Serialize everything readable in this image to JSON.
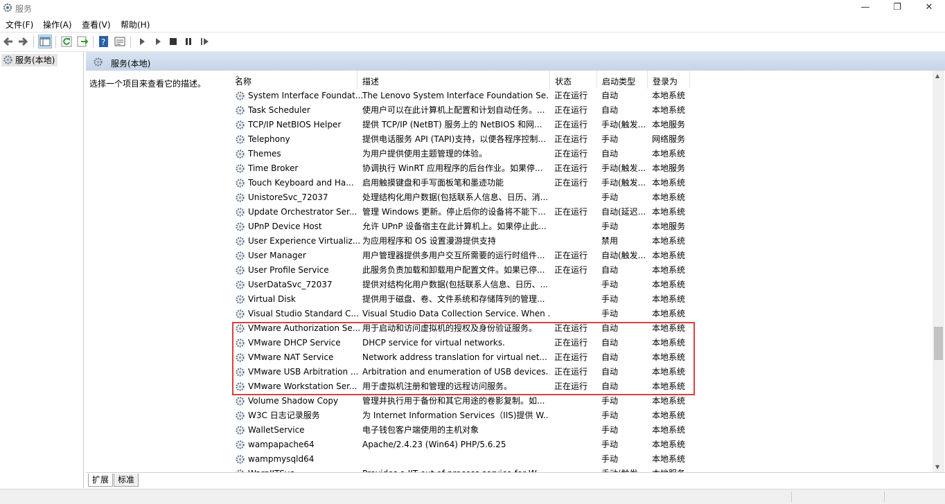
{
  "window": {
    "title": "服务",
    "minimize": "—",
    "maximize": "❐",
    "close": "✕"
  },
  "menu": [
    {
      "label": "文件(F)"
    },
    {
      "label": "操作(A)"
    },
    {
      "label": "查看(V)"
    },
    {
      "label": "帮助(H)"
    }
  ],
  "toolbar": {
    "icons": [
      "back-icon",
      "forward-icon",
      "show-hide-console-tree-icon",
      "refresh-icon",
      "export-list-icon",
      "help-icon",
      "properties-icon",
      "start-service-icon",
      "start-service-alt-icon",
      "stop-service-icon",
      "pause-service-icon",
      "resume-service-icon"
    ]
  },
  "tree": {
    "root_label": "服务(本地)"
  },
  "header": {
    "title": "服务(本地)"
  },
  "description_placeholder": "选择一个项目来查看它的描述。",
  "columns": {
    "name": "名称",
    "desc": "描述",
    "status": "状态",
    "startup": "启动类型",
    "logon": "登录为"
  },
  "services": [
    {
      "name": "System Interface Foundat...",
      "desc": "The Lenovo System Interface Foundation Se...",
      "status": "正在运行",
      "startup": "自动",
      "logon": "本地系统"
    },
    {
      "name": "Task Scheduler",
      "desc": "使用户可以在此计算机上配置和计划自动任务。...",
      "status": "正在运行",
      "startup": "自动",
      "logon": "本地系统"
    },
    {
      "name": "TCP/IP NetBIOS Helper",
      "desc": "提供 TCP/IP (NetBT) 服务上的 NetBIOS 和网...",
      "status": "正在运行",
      "startup": "手动(触发...",
      "logon": "本地服务"
    },
    {
      "name": "Telephony",
      "desc": "提供电话服务 API (TAPI)支持，以便各程序控制...",
      "status": "正在运行",
      "startup": "手动",
      "logon": "网络服务"
    },
    {
      "name": "Themes",
      "desc": "为用户提供使用主题管理的体验。",
      "status": "正在运行",
      "startup": "自动",
      "logon": "本地系统"
    },
    {
      "name": "Time Broker",
      "desc": "协调执行 WinRT 应用程序的后台作业。如果停...",
      "status": "正在运行",
      "startup": "手动(触发...",
      "logon": "本地服务"
    },
    {
      "name": "Touch Keyboard and Ha...",
      "desc": "启用触摸键盘和手写面板笔和墨迹功能",
      "status": "正在运行",
      "startup": "手动(触发...",
      "logon": "本地系统"
    },
    {
      "name": "UnistoreSvc_72037",
      "desc": "处理结构化用户数据(包括联系人信息、日历、消...",
      "status": "",
      "startup": "手动",
      "logon": "本地系统"
    },
    {
      "name": "Update Orchestrator Ser...",
      "desc": "管理 Windows 更新。停止后你的设备将不能下...",
      "status": "正在运行",
      "startup": "自动(延迟...",
      "logon": "本地系统"
    },
    {
      "name": "UPnP Device Host",
      "desc": "允许 UPnP 设备宿主在此计算机上。如果停止此...",
      "status": "",
      "startup": "手动",
      "logon": "本地服务"
    },
    {
      "name": "User Experience Virtualiz...",
      "desc": "为应用程序和 OS 设置漫游提供支持",
      "status": "",
      "startup": "禁用",
      "logon": "本地系统"
    },
    {
      "name": "User Manager",
      "desc": "用户管理器提供多用户交互所需要的运行时组件...",
      "status": "正在运行",
      "startup": "自动(触发...",
      "logon": "本地系统"
    },
    {
      "name": "User Profile Service",
      "desc": "此服务负责加载和卸载用户配置文件。如果已停...",
      "status": "正在运行",
      "startup": "自动",
      "logon": "本地系统"
    },
    {
      "name": "UserDataSvc_72037",
      "desc": "提供对结构化用户数据(包括联系人信息、日历、...",
      "status": "",
      "startup": "手动",
      "logon": "本地系统"
    },
    {
      "name": "Virtual Disk",
      "desc": "提供用于磁盘、卷、文件系统和存储阵列的管理...",
      "status": "",
      "startup": "手动",
      "logon": "本地系统"
    },
    {
      "name": "Visual Studio Standard C...",
      "desc": "Visual Studio Data Collection Service. When ...",
      "status": "",
      "startup": "手动",
      "logon": "本地系统"
    },
    {
      "name": "VMware Authorization Se...",
      "desc": "用于启动和访问虚拟机的授权及身份验证服务。",
      "status": "正在运行",
      "startup": "自动",
      "logon": "本地系统"
    },
    {
      "name": "VMware DHCP Service",
      "desc": "DHCP service for virtual networks.",
      "status": "正在运行",
      "startup": "自动",
      "logon": "本地系统"
    },
    {
      "name": "VMware NAT Service",
      "desc": "Network address translation for virtual net...",
      "status": "正在运行",
      "startup": "自动",
      "logon": "本地系统"
    },
    {
      "name": "VMware USB Arbitration ...",
      "desc": "Arbitration and enumeration of USB devices...",
      "status": "正在运行",
      "startup": "自动",
      "logon": "本地系统"
    },
    {
      "name": "VMware Workstation Ser...",
      "desc": "用于虚拟机注册和管理的远程访问服务。",
      "status": "正在运行",
      "startup": "自动",
      "logon": "本地系统"
    },
    {
      "name": "Volume Shadow Copy",
      "desc": "管理并执行用于备份和其它用途的卷影复制。如...",
      "status": "",
      "startup": "手动",
      "logon": "本地系统"
    },
    {
      "name": "W3C 日志记录服务",
      "desc": "为 Internet Information Services（IIS)提供 W...",
      "status": "",
      "startup": "手动",
      "logon": "本地系统"
    },
    {
      "name": "WalletService",
      "desc": "电子钱包客户端使用的主机对象",
      "status": "",
      "startup": "手动",
      "logon": "本地系统"
    },
    {
      "name": "wampapache64",
      "desc": "Apache/2.4.23 (Win64) PHP/5.6.25",
      "status": "",
      "startup": "手动",
      "logon": "本地系统"
    },
    {
      "name": "wampmysqld64",
      "desc": "",
      "status": "",
      "startup": "手动",
      "logon": "本地系统"
    },
    {
      "name": "WarpJITSvc",
      "desc": "Provides a JIT out of process service for W...",
      "status": "",
      "startup": "手动(触发...",
      "logon": "本地服务"
    }
  ],
  "tabs": [
    {
      "label": "扩展"
    },
    {
      "label": "标准"
    }
  ],
  "colors": {
    "header_band": "#d1deee",
    "highlight_border": "#e03c3c",
    "row_icon": "#6b7c8f"
  }
}
